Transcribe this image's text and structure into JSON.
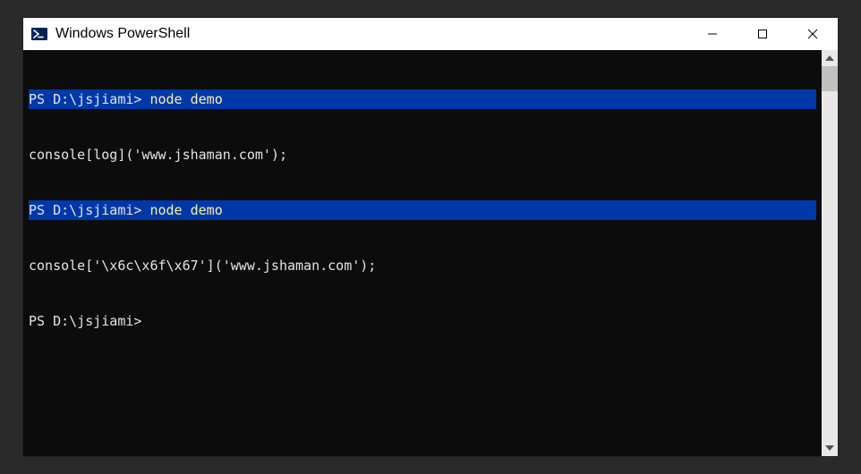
{
  "window": {
    "title": "Windows PowerShell"
  },
  "terminal": {
    "lines": [
      {
        "prompt": "PS D:\\jsjiami> ",
        "command": "node demo",
        "highlighted": true
      },
      {
        "output": "console[log]('www.jshaman.com');"
      },
      {
        "prompt": "PS D:\\jsjiami> ",
        "command": "node demo",
        "highlighted": true
      },
      {
        "output": "console['\\x6c\\x6f\\x67']('www.jshaman.com');"
      },
      {
        "prompt": "PS D:\\jsjiami>",
        "command": "",
        "highlighted": false
      }
    ]
  },
  "colors": {
    "highlight_bg": "#0038a8",
    "terminal_bg": "#0c0c0c",
    "terminal_fg": "#e4e4e4",
    "command_fg": "#f9f1a5"
  }
}
